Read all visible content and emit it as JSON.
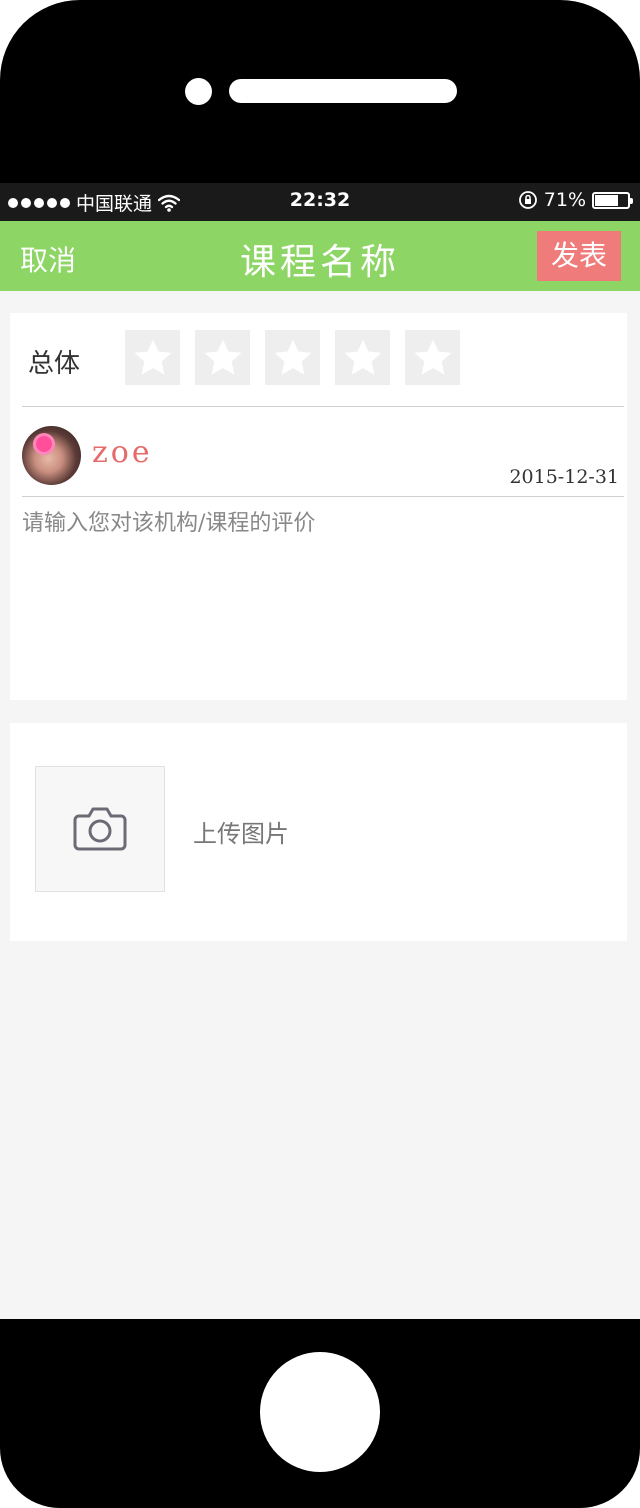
{
  "status_bar": {
    "carrier": "中国联通",
    "time": "22:32",
    "battery": "71%",
    "battery_level": 0.71,
    "icons": [
      "signal-dots-icon",
      "wifi-icon",
      "rotation-lock-icon",
      "battery-icon"
    ]
  },
  "nav": {
    "cancel_label": "取消",
    "title": "课程名称",
    "publish_label": "发表",
    "accent_color": "#8dd565",
    "publish_color": "#ef7b7b"
  },
  "review": {
    "rating_label": "总体",
    "stars": [
      {
        "icon": "star-icon",
        "filled": false
      },
      {
        "icon": "star-icon",
        "filled": false
      },
      {
        "icon": "star-icon",
        "filled": false
      },
      {
        "icon": "star-icon",
        "filled": false
      },
      {
        "icon": "star-icon",
        "filled": false
      }
    ],
    "rating_value": 0,
    "rating_max": 5,
    "username": "zoe",
    "date": "2015-12-31",
    "input_value": "",
    "input_placeholder": "请输入您对该机构/课程的评价"
  },
  "upload": {
    "icon": "camera-icon",
    "label": "上传图片"
  }
}
